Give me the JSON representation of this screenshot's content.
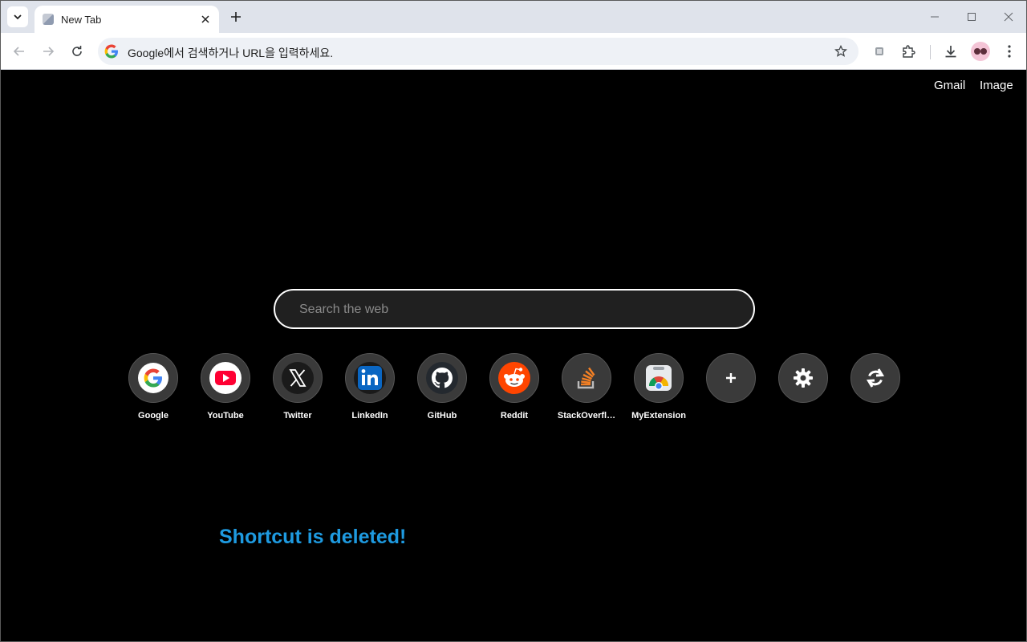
{
  "browser": {
    "tab": {
      "title": "New Tab"
    },
    "omnibox": {
      "text": "Google에서 검색하거나 URL을 입력하세요."
    }
  },
  "page": {
    "links": {
      "gmail": "Gmail",
      "image": "Image"
    },
    "search": {
      "placeholder": "Search the web"
    },
    "shortcuts": [
      {
        "label": "Google",
        "icon": "google-icon"
      },
      {
        "label": "YouTube",
        "icon": "youtube-icon"
      },
      {
        "label": "Twitter",
        "icon": "x-twitter-icon"
      },
      {
        "label": "LinkedIn",
        "icon": "linkedin-icon"
      },
      {
        "label": "GitHub",
        "icon": "github-icon"
      },
      {
        "label": "Reddit",
        "icon": "reddit-icon"
      },
      {
        "label": "StackOverfl…",
        "icon": "stackoverflow-icon"
      },
      {
        "label": "MyExtension",
        "icon": "chrome-icon"
      }
    ],
    "actions": [
      {
        "icon": "plus-icon"
      },
      {
        "icon": "gear-icon"
      },
      {
        "icon": "refresh-icon"
      }
    ],
    "toast": "Shortcut is deleted!"
  },
  "colors": {
    "background": "#000000",
    "tile": "#3a3a3a",
    "toast": "#1e9ae0",
    "search_bg": "#202020"
  }
}
